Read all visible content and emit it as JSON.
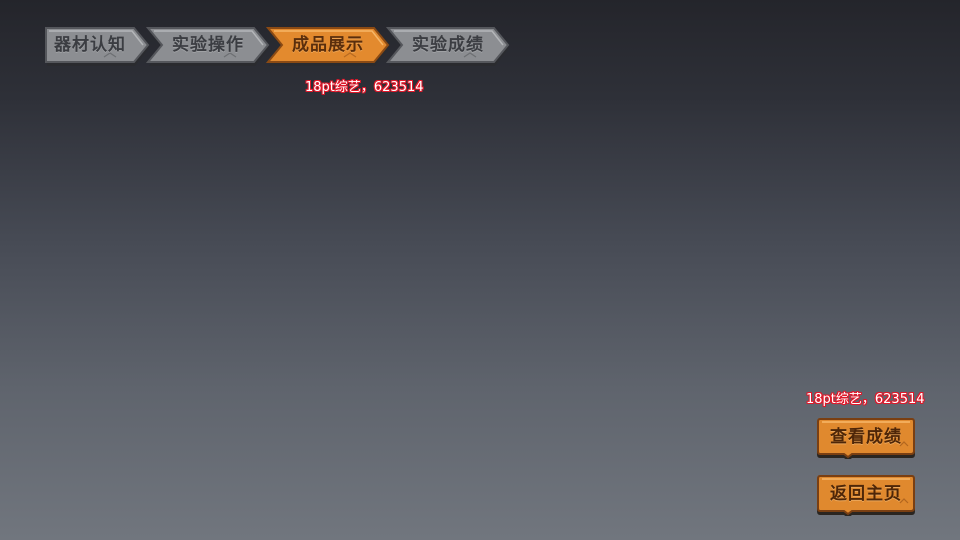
{
  "steps": {
    "items": [
      {
        "label": "器材认知",
        "state": "inactive"
      },
      {
        "label": "实验操作",
        "state": "inactive"
      },
      {
        "label": "成品展示",
        "state": "active"
      },
      {
        "label": "实验成绩",
        "state": "inactive"
      }
    ]
  },
  "annotations": {
    "nav_font_note": "18pt综艺，623514",
    "button_font_note": "18pt综艺，623514"
  },
  "actions": {
    "view_score_label": "查看成绩",
    "back_home_label": "返回主页"
  },
  "colors": {
    "accent_orange": "#e38a2e",
    "step_inactive": "#8e9093",
    "text_dark_brown": "#623514",
    "annotation_red": "#e0182a"
  },
  "icons": {
    "step_shape": "chevron-arrow-tab"
  }
}
